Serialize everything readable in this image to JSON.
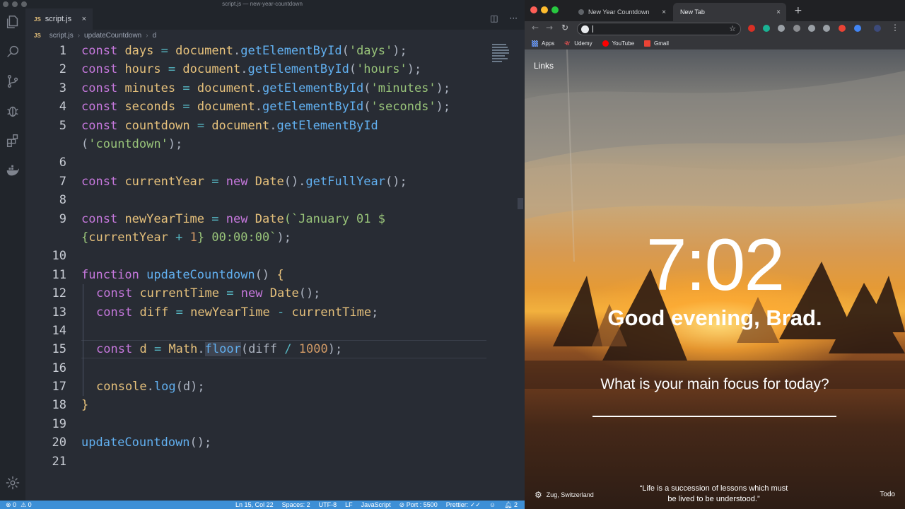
{
  "vscode": {
    "window_title": "script.js — new-year-countdown",
    "tab": {
      "badge": "JS",
      "label": "script.js",
      "close": "×"
    },
    "breadcrumbs": [
      "script.js",
      "updateCountdown",
      "d"
    ],
    "breadcrumb_badge": "JS",
    "line_numbers": [
      "1",
      "2",
      "3",
      "4",
      "5",
      "6",
      "7",
      "8",
      "9",
      "10",
      "11",
      "12",
      "13",
      "14",
      "15",
      "16",
      "17",
      "18",
      "19",
      "20",
      "21"
    ],
    "code": {
      "l1": [
        "const",
        "days",
        "=",
        "document",
        ".",
        "getElementById",
        "(",
        "'days'",
        ");"
      ],
      "l2": [
        "const",
        "hours",
        "=",
        "document",
        ".",
        "getElementById",
        "(",
        "'hours'",
        ");"
      ],
      "l3": [
        "const",
        "minutes",
        "=",
        "document",
        ".",
        "getElementById",
        "(",
        "'minutes'",
        ");"
      ],
      "l4": [
        "const",
        "seconds",
        "=",
        "document",
        ".",
        "getElementById",
        "(",
        "'seconds'",
        ");"
      ],
      "l5": [
        "const",
        "countdown",
        "=",
        "document",
        ".",
        "getElementById"
      ],
      "l5b": [
        "(",
        "'countdown'",
        ");"
      ],
      "l7": [
        "const",
        "currentYear",
        "=",
        "new",
        "Date",
        "().",
        "getFullYear",
        "();"
      ],
      "l9": [
        "const",
        "newYearTime",
        "=",
        "new",
        "Date",
        "(`January 01 $"
      ],
      "l9b": [
        "{",
        "currentYear",
        "+",
        "1",
        "}",
        " 00:00:00`",
        ");"
      ],
      "l11": [
        "function",
        "updateCountdown",
        "()",
        "{"
      ],
      "l12": [
        "const",
        "currentTime",
        "=",
        "new",
        "Date",
        "();"
      ],
      "l13": [
        "const",
        "diff",
        "=",
        "newYearTime",
        "-",
        "currentTime",
        ";"
      ],
      "l15": [
        "const",
        "d",
        "=",
        "Math",
        ".",
        "floor",
        "(diff",
        "/",
        "1000",
        ");"
      ],
      "l17": [
        "console",
        ".",
        "log",
        "(d);"
      ],
      "l18": [
        "}"
      ],
      "l20": [
        "updateCountdown",
        "();"
      ]
    },
    "status": {
      "errors": "0",
      "warnings": "0",
      "position": "Ln 15, Col 22",
      "spaces": "Spaces: 2",
      "encoding": "UTF-8",
      "eol": "LF",
      "language": "JavaScript",
      "port": "Port : 5500",
      "prettier": "Prettier: ✓✓",
      "notifications": "2"
    }
  },
  "browser": {
    "tabs": [
      {
        "label": "New Year Countdown",
        "close": "×",
        "active": false
      },
      {
        "label": "New Tab",
        "close": "×",
        "active": true
      }
    ],
    "new_tab": "+",
    "omnibox": {
      "value": "",
      "placeholder": ""
    },
    "bookmarks": [
      {
        "label": "Apps",
        "icon": "apps-grid-icon"
      },
      {
        "label": "Udemy",
        "icon": "udemy-icon"
      },
      {
        "label": "YouTube",
        "icon": "youtube-icon"
      },
      {
        "label": "Gmail",
        "icon": "gmail-icon"
      }
    ],
    "momentum": {
      "links": "Links",
      "time": "7:02",
      "greeting": "Good evening, Brad.",
      "focus_question": "What is your main focus for today?",
      "location": "Zug, Switzerland",
      "quote_line1": "“Life is a succession of lessons which must",
      "quote_line2": "be lived to be understood.”",
      "todo": "Todo"
    }
  },
  "colors": {
    "status_bar": "#3d8fd6",
    "editor_bg": "#282c34",
    "keyword": "#c678dd",
    "string": "#98c379",
    "function": "#61afef"
  }
}
